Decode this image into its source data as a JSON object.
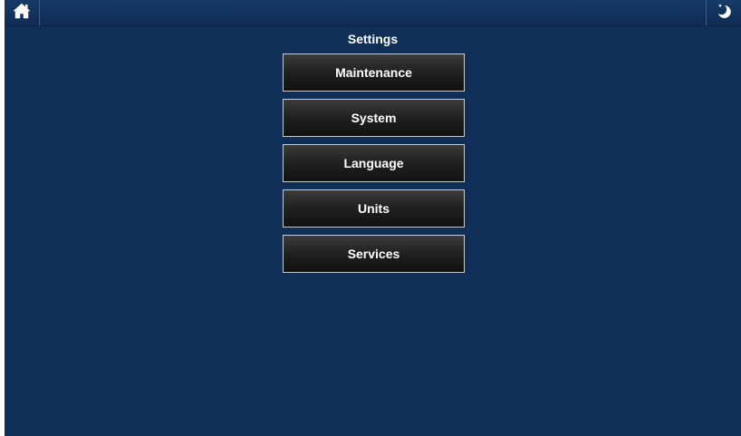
{
  "header": {
    "home_icon": "home-icon",
    "standby_icon": "moon-star-icon"
  },
  "page": {
    "title": "Settings"
  },
  "menu": {
    "items": [
      {
        "label": "Maintenance"
      },
      {
        "label": "System"
      },
      {
        "label": "Language"
      },
      {
        "label": "Units"
      },
      {
        "label": "Services"
      }
    ]
  },
  "colors": {
    "background": "#102f57",
    "button": "#1e1e1e",
    "text": "#ffffff"
  }
}
